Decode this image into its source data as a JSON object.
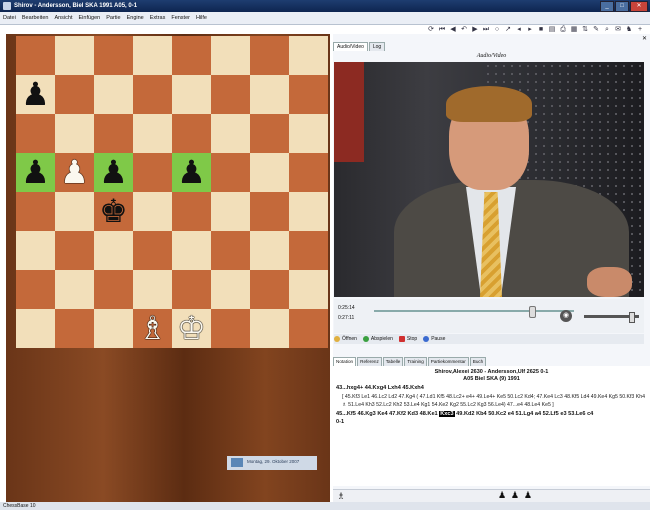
{
  "window": {
    "title": "Shirov - Andersson, Biel SKA 1991  A05, 0-1"
  },
  "menu": [
    "Datei",
    "Bearbeiten",
    "Ansicht",
    "Einfügen",
    "Partie",
    "Engine",
    "Extras",
    "Fenster",
    "Hilfe"
  ],
  "board": {
    "light": "#f2dfba",
    "dark": "#c4693a",
    "highlight": "#7fc948",
    "highlighted": [
      "a5",
      "c5",
      "e5"
    ],
    "pieces": [
      {
        "square": "a7",
        "glyph": "♟",
        "color": "black"
      },
      {
        "square": "a5",
        "glyph": "♟",
        "color": "black"
      },
      {
        "square": "b5",
        "glyph": "♟",
        "color": "white"
      },
      {
        "square": "c5",
        "glyph": "♟",
        "color": "black"
      },
      {
        "square": "e5",
        "glyph": "♟",
        "color": "black"
      },
      {
        "square": "c4",
        "glyph": "♚",
        "color": "black"
      },
      {
        "square": "d1",
        "glyph": "♗",
        "color": "white"
      },
      {
        "square": "e1",
        "glyph": "♔",
        "color": "white"
      }
    ]
  },
  "right_panel": {
    "tabs": [
      "Audio/Video",
      "Log"
    ],
    "header": "Audio/Video",
    "video": {
      "time_current": "0:25:14",
      "time_total": "0:27:11"
    },
    "buttons": [
      "Öffnen",
      "Abspielen",
      "Stop",
      "Pause"
    ]
  },
  "notation": {
    "tabs": [
      "Notation",
      "Referenz",
      "Tabelle",
      "Training",
      "Partiekommentar",
      "Buch"
    ],
    "header": "Shirov,Alexei 2630 - Andersson,Ulf 2625  0-1",
    "sub": "A05 Biel SKA (9) 1991",
    "line1": "43...hxg4+ 44.Kxg4 Lxh4 45.Kxh4",
    "variation": "[ 45.Kf3 Le1 46.Lc2 Ld2 47.Kg4 ( 47.Ld1 Kf5 48.Lc2+ e4+ 49.Le4+ Ke5 50.Lc2 Kd4; 47.Ke4 Lc3 48.Kf5 Ld4 49.Ke4 Kg5 50.Kf3 Kh4 ♗ 51.Le4 Kh3 52.Lc2 Kh2 53.Le4 Kg1 54.Ke2 Kg2 55.Lc2 Kg3 56.Le4) 47...e4 48.Le4 Ke5 ]",
    "line2_prefix": "45...Kf5 46.Kg3 Ke4 47.Kf2 Kd3 48.Ke1",
    "current_move": "Kxc3",
    "line2_suffix": "49.Kd2 Kb4 50.Kc2 e4 51.Lg4 a4 52.Lf5 e3 53.Le6 c4",
    "result": "0-1"
  },
  "bottom": {
    "left_icon": "♗",
    "pawns": "♟ ♟ ♟",
    "date": "Montag, 29. Oktober 2007"
  },
  "status": {
    "text": "ChessBase 10"
  }
}
